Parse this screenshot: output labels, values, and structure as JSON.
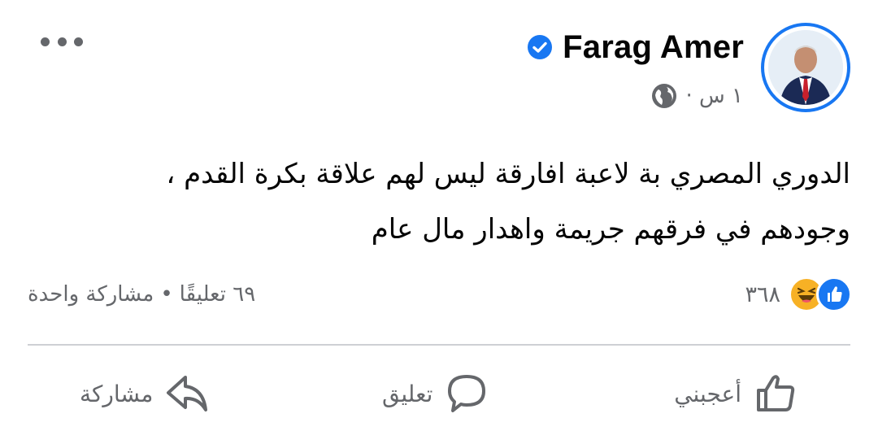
{
  "post": {
    "author_name": "Farag Amer",
    "time": "١ س ·",
    "body_lines": [
      "الدوري المصري بة لاعبة افارقة ليس لهم علاقة بكرة القدم ،",
      "وجودهم في فرقهم جريمة واهدار مال عام"
    ]
  },
  "stats": {
    "reaction_count": "٣٦٨",
    "comments": "٦٩ تعليقًا",
    "separator": "•",
    "shares": "مشاركة واحدة"
  },
  "actions": {
    "like": "أعجبني",
    "comment": "تعليق",
    "share": "مشاركة"
  },
  "colors": {
    "brand_blue": "#1877f2",
    "secondary_text": "#65676b",
    "haha_yellow": "#f7b125"
  },
  "icons": [
    "verified-badge-icon",
    "globe-icon",
    "more-options-icon",
    "like-reaction-icon",
    "haha-reaction-icon",
    "thumbs-up-icon",
    "comment-icon",
    "share-icon"
  ]
}
